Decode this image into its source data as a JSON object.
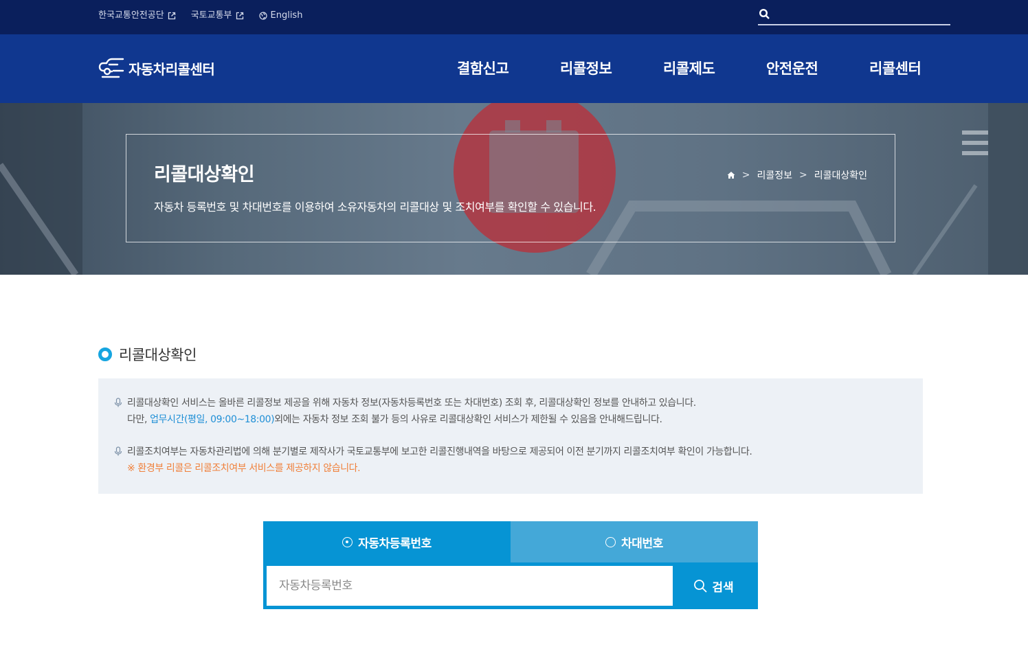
{
  "topbar": {
    "links": [
      {
        "label": "한국교통안전공단",
        "icon": "external-link-icon"
      },
      {
        "label": "국토교통부",
        "icon": "external-link-icon"
      },
      {
        "label": "English",
        "icon": "globe-icon"
      }
    ],
    "search_placeholder": ""
  },
  "nav": {
    "logo_text": "자동차리콜센터",
    "menu": [
      "결함신고",
      "리콜정보",
      "리콜제도",
      "안전운전",
      "리콜센터"
    ]
  },
  "hero": {
    "title": "리콜대상확인",
    "description": "자동차 등록번호 및 차대번호를 이용하여 소유자동차의 리콜대상 및 조치여부를 확인할 수 있습니다.",
    "breadcrumb": [
      "리콜정보",
      "리콜대상확인"
    ]
  },
  "section": {
    "title": "리콜대상확인"
  },
  "info": {
    "p1_line1": "리콜대상확인 서비스는 올바른 리콜정보 제공을 위해 자동차 정보(자동차등록번호 또는 차대번호) 조회 후, 리콜대상확인 정보를 안내하고 있습니다.",
    "p1_line2_prefix": "다만, ",
    "p1_line2_highlight": "업무시간(평일, 09:00~18:00)",
    "p1_line2_suffix": "외에는 자동차 정보 조회 불가 등의 사유로 리콜대상확인 서비스가 제한될 수 있음을 안내해드립니다.",
    "p2_line1": "리콜조치여부는 자동차관리법에 의해 분기별로 제작사가 국토교통부에 보고한 리콜진행내역을 바탕으로 제공되어 이전 분기까지 리콜조치여부 확인이 가능합니다.",
    "p2_warning": "※ 환경부 리콜은 리콜조치여부 서비스를 제공하지 않습니다."
  },
  "search": {
    "tabs": [
      {
        "label": "자동차등록번호",
        "selected": true
      },
      {
        "label": "차대번호",
        "selected": false
      }
    ],
    "input_value": "",
    "input_placeholder": "자동차등록번호",
    "button_label": "검색"
  },
  "colors": {
    "topbar": "#0a1f5c",
    "nav": "#10378f",
    "accent": "#0694d4",
    "highlight": "#1f8fd6",
    "warning": "#f0803a"
  }
}
